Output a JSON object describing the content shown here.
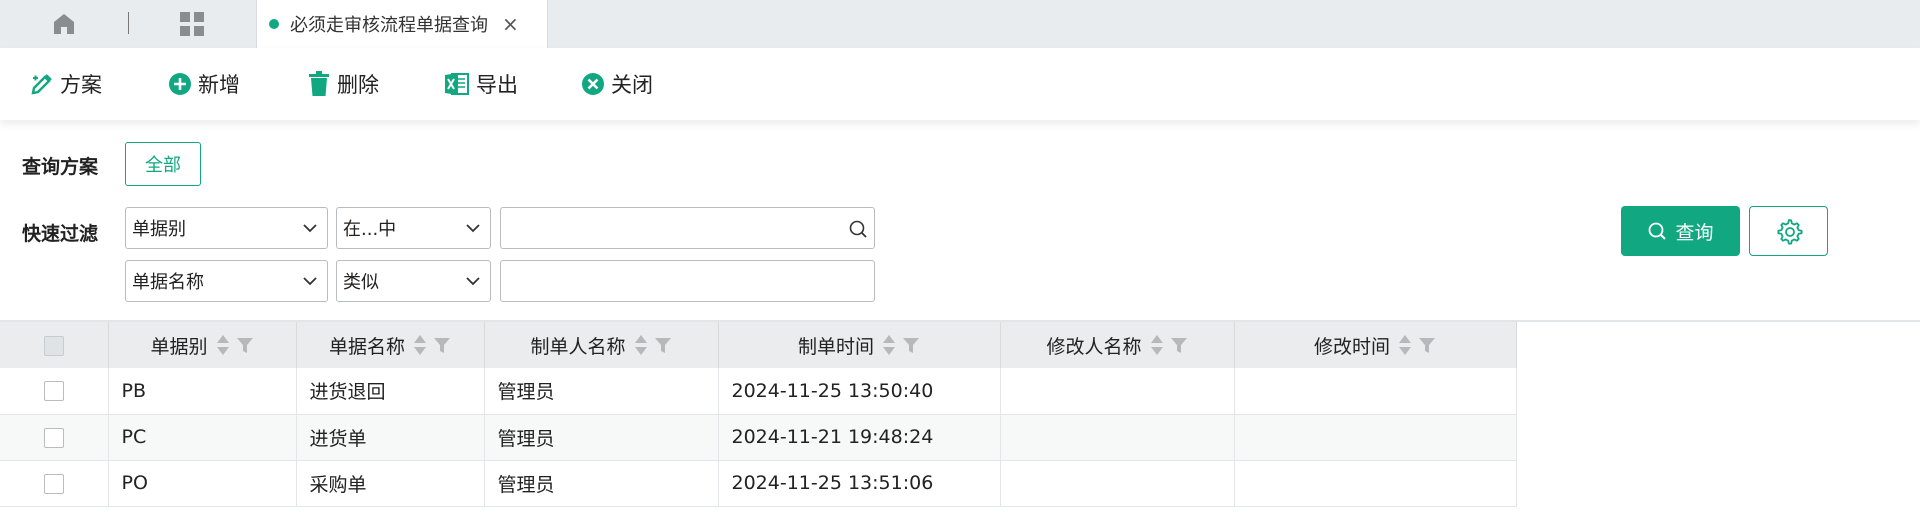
{
  "tabs": {
    "active_title": "必须走审核流程单据查询",
    "close_symbol": "×",
    "icons": [
      "home-icon",
      "apps-grid-icon"
    ]
  },
  "toolbar": {
    "plan_label": "方案",
    "add_label": "新增",
    "delete_label": "删除",
    "export_label": "导出",
    "close_label": "关闭"
  },
  "query": {
    "plan_label": "查询方案",
    "plan_all": "全部",
    "filter_label": "快速过滤",
    "rows": [
      {
        "field": "单据别",
        "operator": "在...中",
        "value": ""
      },
      {
        "field": "单据名称",
        "operator": "类似",
        "value": ""
      }
    ],
    "search_label": "查询"
  },
  "table": {
    "columns": [
      "单据别",
      "单据名称",
      "制单人名称",
      "制单时间",
      "修改人名称",
      "修改时间"
    ],
    "rows": [
      {
        "type": "PB",
        "name": "进货退回",
        "creator": "管理员",
        "created": "2024-11-25 13:50:40",
        "modifier": "",
        "modified": ""
      },
      {
        "type": "PC",
        "name": "进货单",
        "creator": "管理员",
        "created": "2024-11-21 19:48:24",
        "modifier": "",
        "modified": ""
      },
      {
        "type": "PO",
        "name": "采购单",
        "creator": "管理员",
        "created": "2024-11-25 13:51:06",
        "modifier": "",
        "modified": ""
      }
    ]
  },
  "colors": {
    "accent": "#11a881",
    "header_bg": "#eaeced",
    "tabbar_bg": "#e9ecee"
  }
}
